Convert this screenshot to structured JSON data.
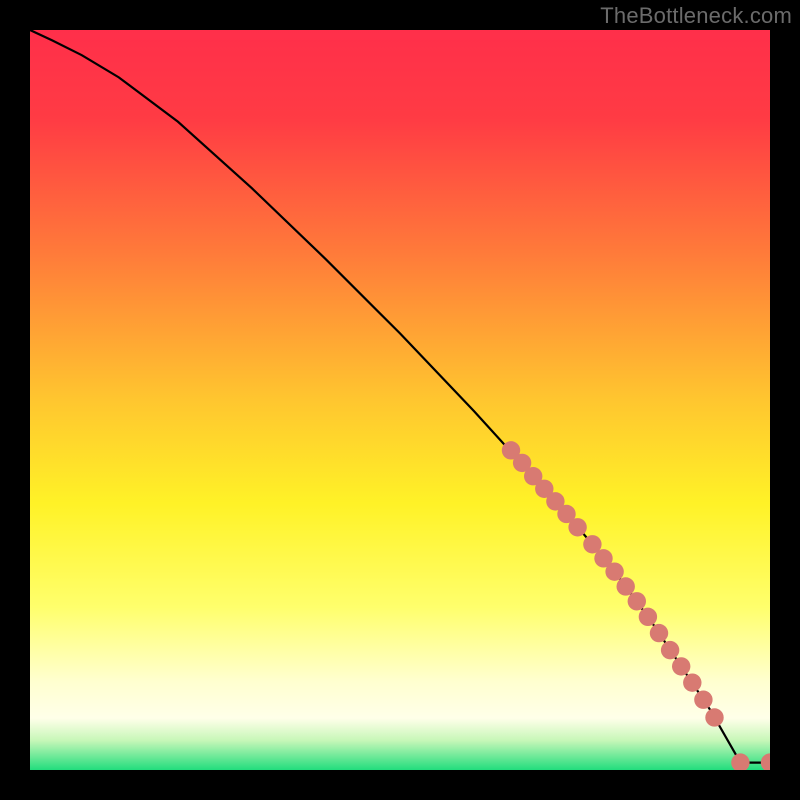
{
  "watermark": "TheBottleneck.com",
  "chart_data": {
    "type": "line",
    "title": "",
    "xlabel": "",
    "ylabel": "",
    "xlim": [
      0,
      100
    ],
    "ylim": [
      0,
      100
    ],
    "curve": {
      "x": [
        0,
        3,
        7,
        12,
        20,
        30,
        40,
        50,
        60,
        70,
        76,
        80,
        84,
        88,
        92,
        96,
        100
      ],
      "y": [
        100,
        98.6,
        96.6,
        93.6,
        87.6,
        78.6,
        69.0,
        59.0,
        48.5,
        37.5,
        30.5,
        25.5,
        20.0,
        14.0,
        8.0,
        1.0,
        1.0
      ]
    },
    "markers": [
      {
        "x": 65,
        "y": 43.2
      },
      {
        "x": 66.5,
        "y": 41.5
      },
      {
        "x": 68,
        "y": 39.7
      },
      {
        "x": 69.5,
        "y": 38.0
      },
      {
        "x": 71,
        "y": 36.3
      },
      {
        "x": 72.5,
        "y": 34.6
      },
      {
        "x": 74,
        "y": 32.8
      },
      {
        "x": 76,
        "y": 30.5
      },
      {
        "x": 77.5,
        "y": 28.6
      },
      {
        "x": 79,
        "y": 26.8
      },
      {
        "x": 80.5,
        "y": 24.8
      },
      {
        "x": 82,
        "y": 22.8
      },
      {
        "x": 83.5,
        "y": 20.7
      },
      {
        "x": 85,
        "y": 18.5
      },
      {
        "x": 86.5,
        "y": 16.2
      },
      {
        "x": 88,
        "y": 14.0
      },
      {
        "x": 89.5,
        "y": 11.8
      },
      {
        "x": 91,
        "y": 9.5
      },
      {
        "x": 92.5,
        "y": 7.1
      },
      {
        "x": 96,
        "y": 1.0
      },
      {
        "x": 100,
        "y": 1.0
      }
    ],
    "gradient_stops": [
      {
        "offset": 0.0,
        "color": "#ff2f4a"
      },
      {
        "offset": 0.12,
        "color": "#ff3b44"
      },
      {
        "offset": 0.3,
        "color": "#ff7a3a"
      },
      {
        "offset": 0.5,
        "color": "#ffc62f"
      },
      {
        "offset": 0.64,
        "color": "#fff227"
      },
      {
        "offset": 0.78,
        "color": "#ffff6c"
      },
      {
        "offset": 0.88,
        "color": "#ffffcf"
      },
      {
        "offset": 0.93,
        "color": "#ffffe9"
      },
      {
        "offset": 0.96,
        "color": "#c7f7b8"
      },
      {
        "offset": 1.0,
        "color": "#22dd7d"
      }
    ],
    "marker_color": "#d87a72",
    "line_color": "#000000"
  }
}
